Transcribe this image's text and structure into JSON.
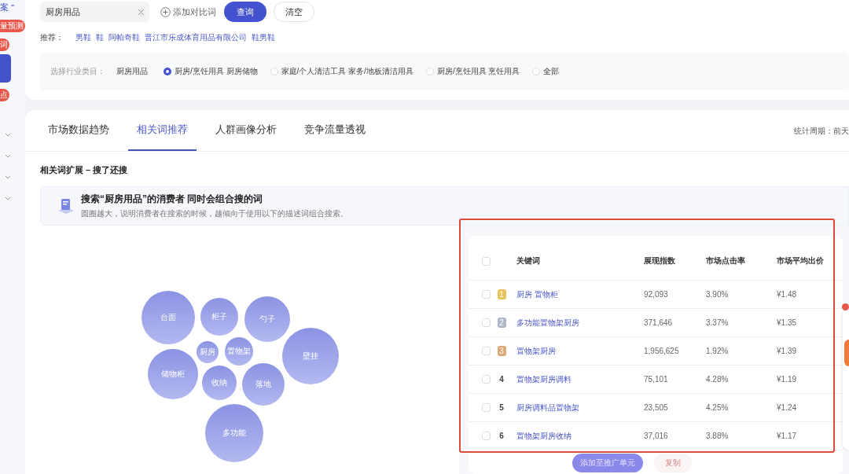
{
  "sidebar": {
    "items": [
      {
        "text": "案",
        "caret": "⌃",
        "kind": "link"
      },
      {
        "text": "量预测",
        "kind": "badge"
      },
      {
        "text": "词",
        "kind": "badge"
      },
      {
        "kind": "block"
      },
      {
        "text": "点",
        "kind": "badge"
      }
    ]
  },
  "search": {
    "value": "厨房用品",
    "add_compare": "添加对比词",
    "query_button": "查询",
    "clear_button": "清空"
  },
  "recommend": {
    "label": "推荐：",
    "items": [
      "男鞋",
      "鞋",
      "阿帕奇鞋",
      "晋江市乐成体育用品有限公司",
      "鞋男鞋"
    ]
  },
  "category": {
    "label": "选择行业类目：",
    "root": "厨房用品",
    "options": [
      {
        "label": "厨房/烹饪用具 厨房储物",
        "selected": true
      },
      {
        "label": "家庭/个人清洁工具 家务/地板清洁用具",
        "selected": false
      },
      {
        "label": "厨房/烹饪用具 烹饪用具",
        "selected": false
      },
      {
        "label": "全部",
        "selected": false
      }
    ]
  },
  "tabs": [
    {
      "label": "市场数据趋势",
      "selected": false
    },
    {
      "label": "相关词推荐",
      "selected": true
    },
    {
      "label": "人群画像分析",
      "selected": false
    },
    {
      "label": "竞争流量透视",
      "selected": false
    }
  ],
  "period": "统计周期：前天",
  "section_title": "相关词扩展 – 搜了还搜",
  "info": {
    "headline": "搜索“厨房用品”的消费者 **同时会组合搜的词**",
    "note": "圆圈越大，说明消费者在搜索的时候，越倾向于使用以下的描述词组合搜索。"
  },
  "bubbles": [
    "台面",
    "柜子",
    "勺子",
    "厨房",
    "置物架",
    "壁挂",
    "储物柜",
    "收纳",
    "落地",
    "多功能"
  ],
  "table": {
    "header_checked": false,
    "columns": [
      "关键词",
      "展现指数",
      "市场点击率",
      "市场平均出价"
    ],
    "rows": [
      {
        "checked": false,
        "kind": "medal",
        "rank": "1",
        "color": "#e9c45c",
        "keyword": "厨房 置物柜",
        "impressions": "92,093",
        "ctr": "3.90%",
        "bid": "¥1.48"
      },
      {
        "checked": false,
        "kind": "medal",
        "rank": "2",
        "color": "#aeb6c8",
        "keyword": "多功能置物架厨房",
        "impressions": "371,646",
        "ctr": "3.37%",
        "bid": "¥1.35"
      },
      {
        "checked": false,
        "kind": "medal",
        "rank": "3",
        "color": "#dba878",
        "keyword": "置物架厨房",
        "impressions": "1,956,625",
        "ctr": "1.92%",
        "bid": "¥1.39"
      },
      {
        "checked": false,
        "kind": "number",
        "rank": "4",
        "keyword": "置物架厨房调料",
        "impressions": "75,101",
        "ctr": "4.28%",
        "bid": "¥1.19"
      },
      {
        "checked": false,
        "kind": "number",
        "rank": "5",
        "keyword": "厨房调料品置物架",
        "impressions": "23,505",
        "ctr": "4.25%",
        "bid": "¥1.24"
      },
      {
        "checked": false,
        "kind": "number",
        "rank": "6",
        "keyword": "置物架厨房收纳",
        "impressions": "37,016",
        "ctr": "3.88%",
        "bid": "¥1.17"
      }
    ],
    "buttons": [
      {
        "label": "添加至推广单元",
        "kind": "primary"
      },
      {
        "label": "复制",
        "kind": "plain"
      }
    ]
  }
}
